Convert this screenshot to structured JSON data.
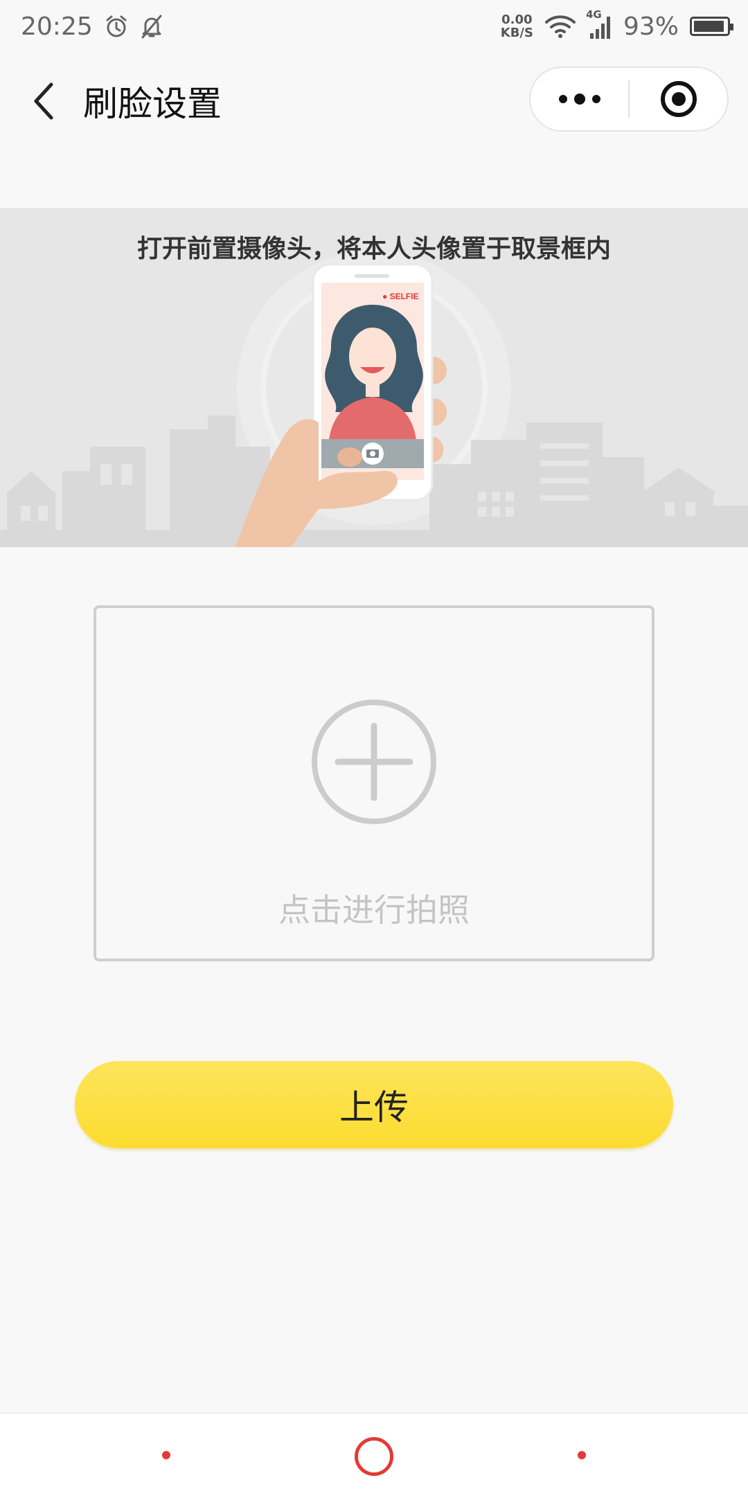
{
  "status_bar": {
    "time": "20:25",
    "net_speed_value": "0.00",
    "net_speed_unit": "KB/S",
    "network_type": "4G",
    "battery": "93%",
    "battery_level": 0.93
  },
  "nav": {
    "title": "刷脸设置"
  },
  "banner": {
    "instruction": "打开前置摄像头，将本人头像置于取景框内",
    "selfie_label": "● SELFIE"
  },
  "photo_box": {
    "hint": "点击进行拍照"
  },
  "upload_button": {
    "label": "上传"
  },
  "colors": {
    "accent_yellow": "#fcdc30",
    "nav_red": "#e53935"
  }
}
